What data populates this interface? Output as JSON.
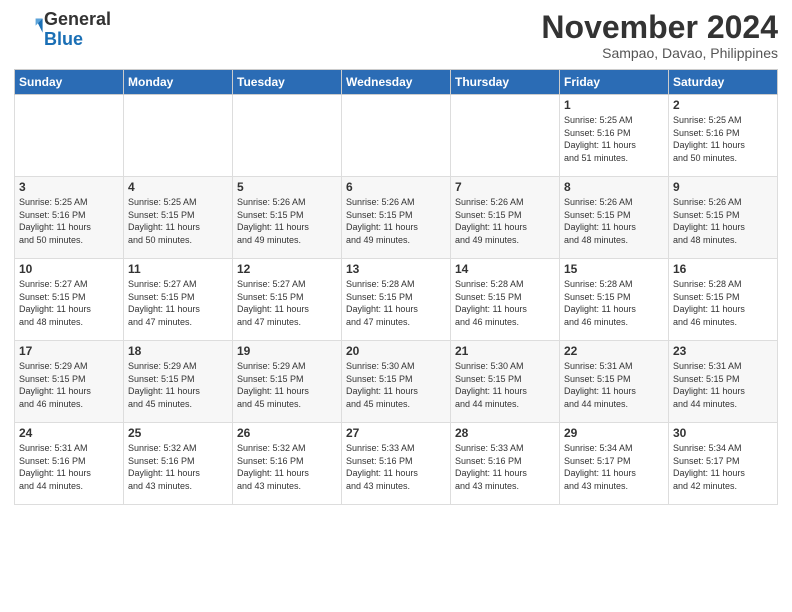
{
  "logo": {
    "general": "General",
    "blue": "Blue"
  },
  "header": {
    "month": "November 2024",
    "location": "Sampao, Davao, Philippines"
  },
  "days_of_week": [
    "Sunday",
    "Monday",
    "Tuesday",
    "Wednesday",
    "Thursday",
    "Friday",
    "Saturday"
  ],
  "weeks": [
    [
      {
        "day": "",
        "info": ""
      },
      {
        "day": "",
        "info": ""
      },
      {
        "day": "",
        "info": ""
      },
      {
        "day": "",
        "info": ""
      },
      {
        "day": "",
        "info": ""
      },
      {
        "day": "1",
        "info": "Sunrise: 5:25 AM\nSunset: 5:16 PM\nDaylight: 11 hours\nand 51 minutes."
      },
      {
        "day": "2",
        "info": "Sunrise: 5:25 AM\nSunset: 5:16 PM\nDaylight: 11 hours\nand 50 minutes."
      }
    ],
    [
      {
        "day": "3",
        "info": "Sunrise: 5:25 AM\nSunset: 5:16 PM\nDaylight: 11 hours\nand 50 minutes."
      },
      {
        "day": "4",
        "info": "Sunrise: 5:25 AM\nSunset: 5:15 PM\nDaylight: 11 hours\nand 50 minutes."
      },
      {
        "day": "5",
        "info": "Sunrise: 5:26 AM\nSunset: 5:15 PM\nDaylight: 11 hours\nand 49 minutes."
      },
      {
        "day": "6",
        "info": "Sunrise: 5:26 AM\nSunset: 5:15 PM\nDaylight: 11 hours\nand 49 minutes."
      },
      {
        "day": "7",
        "info": "Sunrise: 5:26 AM\nSunset: 5:15 PM\nDaylight: 11 hours\nand 49 minutes."
      },
      {
        "day": "8",
        "info": "Sunrise: 5:26 AM\nSunset: 5:15 PM\nDaylight: 11 hours\nand 48 minutes."
      },
      {
        "day": "9",
        "info": "Sunrise: 5:26 AM\nSunset: 5:15 PM\nDaylight: 11 hours\nand 48 minutes."
      }
    ],
    [
      {
        "day": "10",
        "info": "Sunrise: 5:27 AM\nSunset: 5:15 PM\nDaylight: 11 hours\nand 48 minutes."
      },
      {
        "day": "11",
        "info": "Sunrise: 5:27 AM\nSunset: 5:15 PM\nDaylight: 11 hours\nand 47 minutes."
      },
      {
        "day": "12",
        "info": "Sunrise: 5:27 AM\nSunset: 5:15 PM\nDaylight: 11 hours\nand 47 minutes."
      },
      {
        "day": "13",
        "info": "Sunrise: 5:28 AM\nSunset: 5:15 PM\nDaylight: 11 hours\nand 47 minutes."
      },
      {
        "day": "14",
        "info": "Sunrise: 5:28 AM\nSunset: 5:15 PM\nDaylight: 11 hours\nand 46 minutes."
      },
      {
        "day": "15",
        "info": "Sunrise: 5:28 AM\nSunset: 5:15 PM\nDaylight: 11 hours\nand 46 minutes."
      },
      {
        "day": "16",
        "info": "Sunrise: 5:28 AM\nSunset: 5:15 PM\nDaylight: 11 hours\nand 46 minutes."
      }
    ],
    [
      {
        "day": "17",
        "info": "Sunrise: 5:29 AM\nSunset: 5:15 PM\nDaylight: 11 hours\nand 46 minutes."
      },
      {
        "day": "18",
        "info": "Sunrise: 5:29 AM\nSunset: 5:15 PM\nDaylight: 11 hours\nand 45 minutes."
      },
      {
        "day": "19",
        "info": "Sunrise: 5:29 AM\nSunset: 5:15 PM\nDaylight: 11 hours\nand 45 minutes."
      },
      {
        "day": "20",
        "info": "Sunrise: 5:30 AM\nSunset: 5:15 PM\nDaylight: 11 hours\nand 45 minutes."
      },
      {
        "day": "21",
        "info": "Sunrise: 5:30 AM\nSunset: 5:15 PM\nDaylight: 11 hours\nand 44 minutes."
      },
      {
        "day": "22",
        "info": "Sunrise: 5:31 AM\nSunset: 5:15 PM\nDaylight: 11 hours\nand 44 minutes."
      },
      {
        "day": "23",
        "info": "Sunrise: 5:31 AM\nSunset: 5:15 PM\nDaylight: 11 hours\nand 44 minutes."
      }
    ],
    [
      {
        "day": "24",
        "info": "Sunrise: 5:31 AM\nSunset: 5:16 PM\nDaylight: 11 hours\nand 44 minutes."
      },
      {
        "day": "25",
        "info": "Sunrise: 5:32 AM\nSunset: 5:16 PM\nDaylight: 11 hours\nand 43 minutes."
      },
      {
        "day": "26",
        "info": "Sunrise: 5:32 AM\nSunset: 5:16 PM\nDaylight: 11 hours\nand 43 minutes."
      },
      {
        "day": "27",
        "info": "Sunrise: 5:33 AM\nSunset: 5:16 PM\nDaylight: 11 hours\nand 43 minutes."
      },
      {
        "day": "28",
        "info": "Sunrise: 5:33 AM\nSunset: 5:16 PM\nDaylight: 11 hours\nand 43 minutes."
      },
      {
        "day": "29",
        "info": "Sunrise: 5:34 AM\nSunset: 5:17 PM\nDaylight: 11 hours\nand 43 minutes."
      },
      {
        "day": "30",
        "info": "Sunrise: 5:34 AM\nSunset: 5:17 PM\nDaylight: 11 hours\nand 42 minutes."
      }
    ]
  ]
}
